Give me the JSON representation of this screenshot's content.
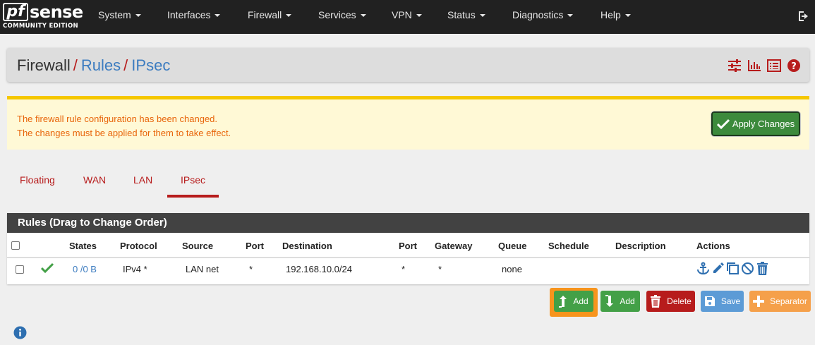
{
  "brand": {
    "logo_text": "pf",
    "logo_text2": "sense",
    "edition": "COMMUNITY EDITION"
  },
  "nav": {
    "items": [
      "System",
      "Interfaces",
      "Firewall",
      "Services",
      "VPN",
      "Status",
      "Diagnostics",
      "Help"
    ],
    "logout_icon": "sign-out-icon"
  },
  "breadcrumb": {
    "part1": "Firewall",
    "part2": "Rules",
    "part3": "IPsec",
    "separator": "/"
  },
  "header_icons": [
    "sliders-icon",
    "bar-chart-icon",
    "list-icon",
    "question-circle-icon"
  ],
  "alert": {
    "line1": "The firewall rule configuration has been changed.",
    "line2": "The changes must be applied for them to take effect.",
    "apply_label": "Apply Changes"
  },
  "tabs": {
    "items": [
      "Floating",
      "WAN",
      "LAN",
      "IPsec"
    ],
    "active": "IPsec"
  },
  "rules": {
    "title": "Rules (Drag to Change Order)",
    "columns": [
      "States",
      "Protocol",
      "Source",
      "Port",
      "Destination",
      "Port",
      "Gateway",
      "Queue",
      "Schedule",
      "Description",
      "Actions"
    ],
    "rows": [
      {
        "states": "0 /0 B",
        "protocol": "IPv4 *",
        "source": "LAN net",
        "source_port": "*",
        "destination": "192.168.10.0/24",
        "dest_port": "*",
        "gateway": "*",
        "queue": "none",
        "schedule": "",
        "description": ""
      }
    ],
    "row_action_icons": [
      "anchor-icon",
      "pencil-icon",
      "copy-icon",
      "ban-icon",
      "trash-icon"
    ]
  },
  "buttons": {
    "add_top": "Add",
    "add_bottom": "Add",
    "delete": "Delete",
    "save": "Save",
    "separator": "Separator"
  },
  "colors": {
    "nav_bg": "#212121",
    "accent_red": "#b71c1c",
    "link_blue": "#3c7cc0",
    "alert_bg": "#fff9d6",
    "alert_text": "#e8650a",
    "success": "#43a047",
    "danger": "#b71c1c",
    "info": "#5c9bd6",
    "warning": "#f5a04a",
    "highlight": "#f7941d"
  }
}
